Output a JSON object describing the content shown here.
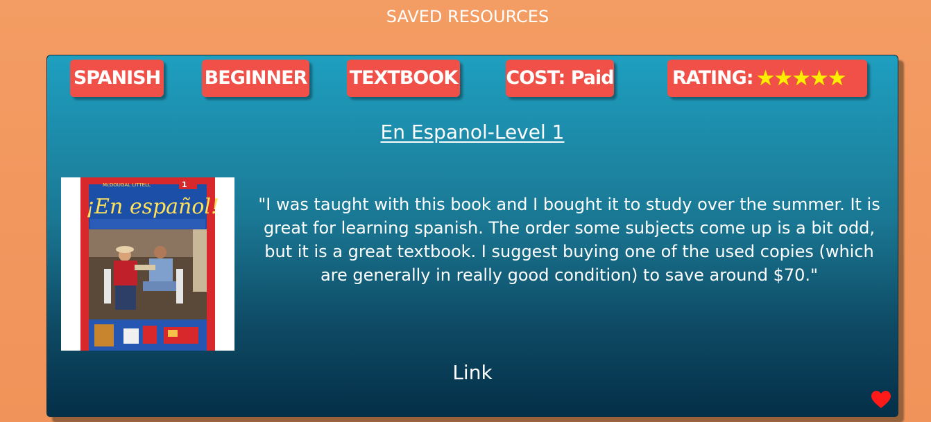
{
  "page": {
    "title": "SAVED RESOURCES"
  },
  "resource": {
    "tags": {
      "language": "SPANISH",
      "level": "BEGINNER",
      "type": "TEXTBOOK",
      "cost": "COST: Paid",
      "rating_label": "RATING:"
    },
    "rating": 5,
    "rating_max": 5,
    "title": "En Espanol-Level 1",
    "cover": {
      "publisher": "McDOUGAL LITTELL",
      "title": "¡En español!",
      "level_badge": "1"
    },
    "review": "\"I was taught with this book and I bought it to study over the summer. It is great for learning spanish. The order some subjects come up is a bit odd, but it is a great textbook. I suggest buying one of the used copies (which are generally in really good condition) to save around $70.\"",
    "link_label": "Link",
    "favorite_icon": "heart-icon"
  },
  "colors": {
    "background": "#f39c63",
    "card_top": "#1f9fc0",
    "card_bottom": "#042f48",
    "tag": "#f05048",
    "star": "#ffee00",
    "heart": "#ff1a1a"
  }
}
